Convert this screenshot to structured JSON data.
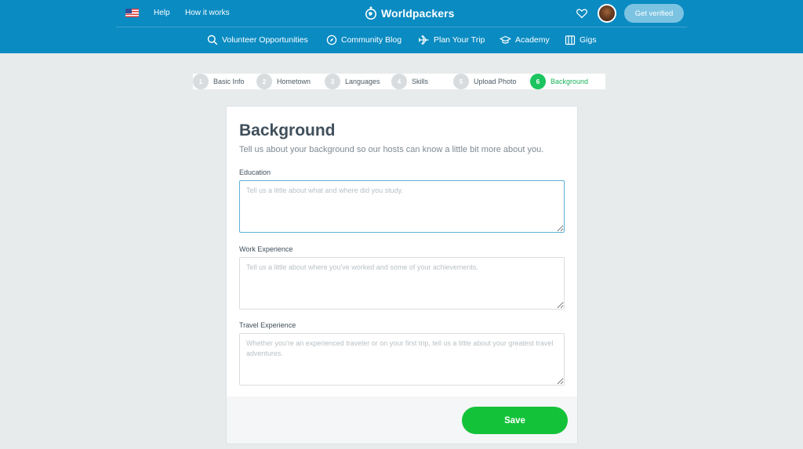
{
  "header": {
    "help": "Help",
    "how_it_works": "How it works",
    "brand": "Worldpackers",
    "verify_button": "Get verified"
  },
  "nav": [
    {
      "label": "Volunteer Opportunities",
      "icon": "search-icon"
    },
    {
      "label": "Community Blog",
      "icon": "compass-icon"
    },
    {
      "label": "Plan Your Trip",
      "icon": "airplane-icon"
    },
    {
      "label": "Academy",
      "icon": "graduation-cap-icon"
    },
    {
      "label": "Gigs",
      "icon": "gigs-icon"
    }
  ],
  "steps": [
    {
      "num": "1",
      "label": "Basic Info"
    },
    {
      "num": "2",
      "label": "Hometown"
    },
    {
      "num": "3",
      "label": "Languages"
    },
    {
      "num": "4",
      "label": "Skills"
    },
    {
      "num": "5",
      "label": "Upload Photo"
    },
    {
      "num": "6",
      "label": "Background",
      "active": true
    }
  ],
  "form": {
    "title": "Background",
    "subtitle": "Tell us about your background so our hosts can know a little bit more about you.",
    "education": {
      "label": "Education",
      "placeholder": "Tell us a little about what and where did you study.",
      "value": ""
    },
    "work": {
      "label": "Work Experience",
      "placeholder": "Tell us a little about where you've worked and some of your achievements.",
      "value": ""
    },
    "travel": {
      "label": "Travel Experience",
      "placeholder": "Whether you're an experienced traveler or on your first trip, tell us a little about your greatest travel adventures.",
      "value": ""
    },
    "save_label": "Save"
  },
  "colors": {
    "header_bg": "#0a8bc2",
    "active_step": "#1bc45e",
    "save_button": "#14c23a",
    "verify_button": "#7cc3e2",
    "focus_border": "#5fb0d8"
  }
}
